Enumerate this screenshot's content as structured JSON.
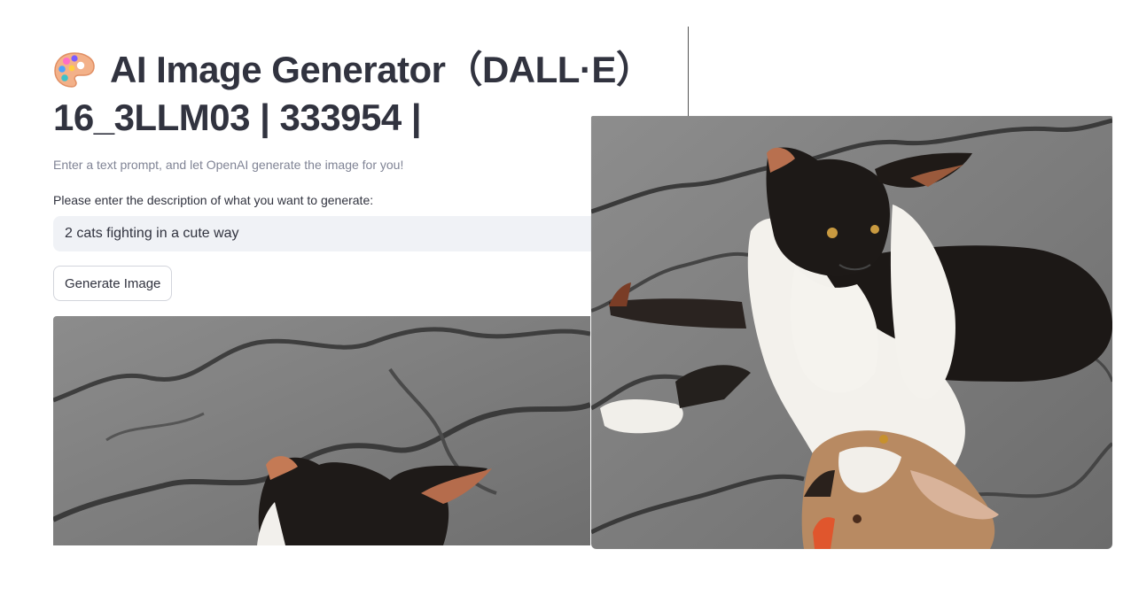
{
  "app": {
    "title_line1": "AI Image Generator（DALL·E）",
    "title_line2": "16_3LLM03 | 333954 |",
    "title_icon": "artist-palette-icon",
    "caption": "Enter a text prompt, and let OpenAI generate the image for you!"
  },
  "form": {
    "prompt_label": "Please enter the description of what you want to generate:",
    "prompt_value": "2 cats fighting in a cute way",
    "generate_label": "Generate Image"
  },
  "result": {
    "image_subject": "two-cats-playfighting-image"
  },
  "colors": {
    "text": "#31333f",
    "caption": "#808495",
    "input_bg": "#f0f2f6",
    "button_border": "#d3d5dc"
  }
}
